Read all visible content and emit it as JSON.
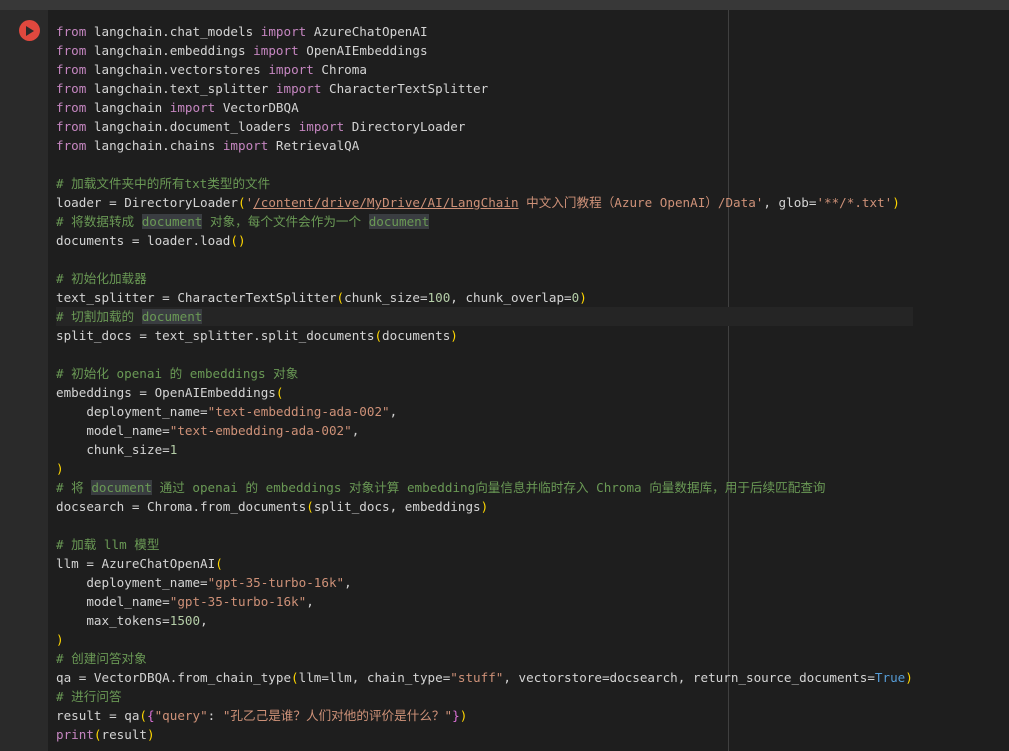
{
  "cell": {
    "run_button_icon": "play-icon",
    "lines": [
      {
        "kind": "import",
        "a": "from",
        "b": " langchain.chat_models ",
        "c": "import",
        "d": " AzureChatOpenAI"
      },
      {
        "kind": "import",
        "a": "from",
        "b": " langchain.embeddings ",
        "c": "import",
        "d": " OpenAIEmbeddings"
      },
      {
        "kind": "import",
        "a": "from",
        "b": " langchain.vectorstores ",
        "c": "import",
        "d": " Chroma"
      },
      {
        "kind": "import",
        "a": "from",
        "b": " langchain.text_splitter ",
        "c": "import",
        "d": " CharacterTextSplitter"
      },
      {
        "kind": "import",
        "a": "from",
        "b": " langchain ",
        "c": "import",
        "d": " VectorDBQA"
      },
      {
        "kind": "import",
        "a": "from",
        "b": " langchain.document_loaders ",
        "c": "import",
        "d": " DirectoryLoader"
      },
      {
        "kind": "import",
        "a": "from",
        "b": " langchain.chains ",
        "c": "import",
        "d": " RetrievalQA"
      },
      {
        "kind": "blank"
      },
      {
        "kind": "comment",
        "text": "# 加载文件夹中的所有txt类型的文件"
      },
      {
        "kind": "loader",
        "a": "loader = DirectoryLoader",
        "b": "(",
        "c": "'",
        "d": "/content/drive/MyDrive/AI/LangChain",
        "e": " 中文入门教程（Azure OpenAI）/Data'",
        "f": ", glob=",
        "g": "'**/*.txt'",
        "h": ")"
      },
      {
        "kind": "comment_hl",
        "a": "# 将数据转成 ",
        "b": "document",
        "c": " 对象，每个文件会作为一个 ",
        "d": "document"
      },
      {
        "kind": "call0",
        "a": "documents = loader.load",
        "b": "()"
      },
      {
        "kind": "blank"
      },
      {
        "kind": "comment",
        "text": "# 初始化加载器"
      },
      {
        "kind": "splitter",
        "a": "text_splitter = CharacterTextSplitter",
        "b": "(",
        "c": "chunk_size=",
        "d": "100",
        "e": ", chunk_overlap=",
        "f": "0",
        "g": ")"
      },
      {
        "kind": "comment_hl2",
        "a": "# 切割加载的 ",
        "b": "document"
      },
      {
        "kind": "call1",
        "a": "split_docs = text_splitter.split_documents",
        "b": "(",
        "c": "documents",
        "d": ")"
      },
      {
        "kind": "blank"
      },
      {
        "kind": "comment",
        "text": "# 初始化 openai 的 embeddings 对象"
      },
      {
        "kind": "open",
        "a": "embeddings = OpenAIEmbeddings",
        "b": "("
      },
      {
        "kind": "kwarg",
        "a": "    deployment_name=",
        "b": "\"text-embedding-ada-002\"",
        "c": ","
      },
      {
        "kind": "kwarg",
        "a": "    model_name=",
        "b": "\"text-embedding-ada-002\"",
        "c": ","
      },
      {
        "kind": "kwargnum",
        "a": "    chunk_size=",
        "b": "1"
      },
      {
        "kind": "close",
        "a": ")"
      },
      {
        "kind": "comment_hl3",
        "a": "# 将 ",
        "b": "document",
        "c": " 通过 openai 的 embeddings 对象计算 embedding向量信息并临时存入 Chroma 向量数据库，用于后续匹配查询"
      },
      {
        "kind": "call1",
        "a": "docsearch = Chroma.from_documents",
        "b": "(",
        "c": "split_docs, embeddings",
        "d": ")"
      },
      {
        "kind": "blank"
      },
      {
        "kind": "comment",
        "text": "# 加载 llm 模型"
      },
      {
        "kind": "open",
        "a": "llm = AzureChatOpenAI",
        "b": "("
      },
      {
        "kind": "kwarg",
        "a": "    deployment_name=",
        "b": "\"gpt-35-turbo-16k\"",
        "c": ","
      },
      {
        "kind": "kwarg",
        "a": "    model_name=",
        "b": "\"gpt-35-turbo-16k\"",
        "c": ","
      },
      {
        "kind": "kwargnum",
        "a": "    max_tokens=",
        "b": "1500",
        "c": ","
      },
      {
        "kind": "close",
        "a": ")"
      },
      {
        "kind": "comment",
        "text": "# 创建问答对象"
      },
      {
        "kind": "qa",
        "a": "qa = VectorDBQA.from_chain_type",
        "b": "(",
        "c": "llm=llm, chain_type=",
        "d": "\"stuff\"",
        "e": ", vectorstore=docsearch, return_source_documents=",
        "f": "True",
        "g": ")"
      },
      {
        "kind": "comment",
        "text": "# 进行问答"
      },
      {
        "kind": "result",
        "a": "result = qa",
        "b": "(",
        "c": "{",
        "d": "\"query\"",
        "e": ": ",
        "f": "\"孔乙己是谁？人们对他的评价是什么？\"",
        "g": "}",
        "h": ")"
      },
      {
        "kind": "print",
        "a": "print",
        "b": "(",
        "c": "result",
        "d": ")"
      }
    ]
  }
}
